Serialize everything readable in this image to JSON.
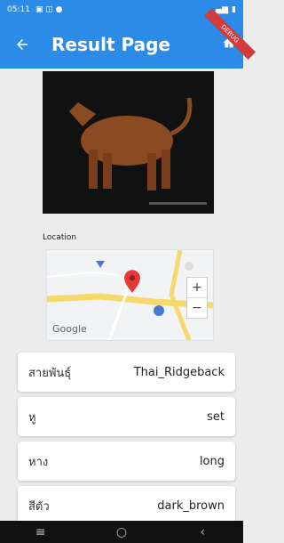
{
  "status_bar": {
    "time": "05:11"
  },
  "app_bar": {
    "title": "Result Page"
  },
  "debug_ribbon": "DEBUG",
  "location": {
    "label": "Location",
    "map_brand": "Google",
    "zoom_in": "+",
    "zoom_out": "−"
  },
  "results": [
    {
      "label": "สายพันธุ์",
      "value": "Thai_Ridgeback"
    },
    {
      "label": "หู",
      "value": "set"
    },
    {
      "label": "หาง",
      "value": "long"
    },
    {
      "label": "สีตัว",
      "value": "dark_brown"
    }
  ],
  "colors": {
    "primary": "#2d8be8",
    "background": "#ececec",
    "card": "#ffffff"
  },
  "icons": {
    "back": "arrow-left-icon",
    "home": "home-icon",
    "pin": "map-pin-icon"
  }
}
